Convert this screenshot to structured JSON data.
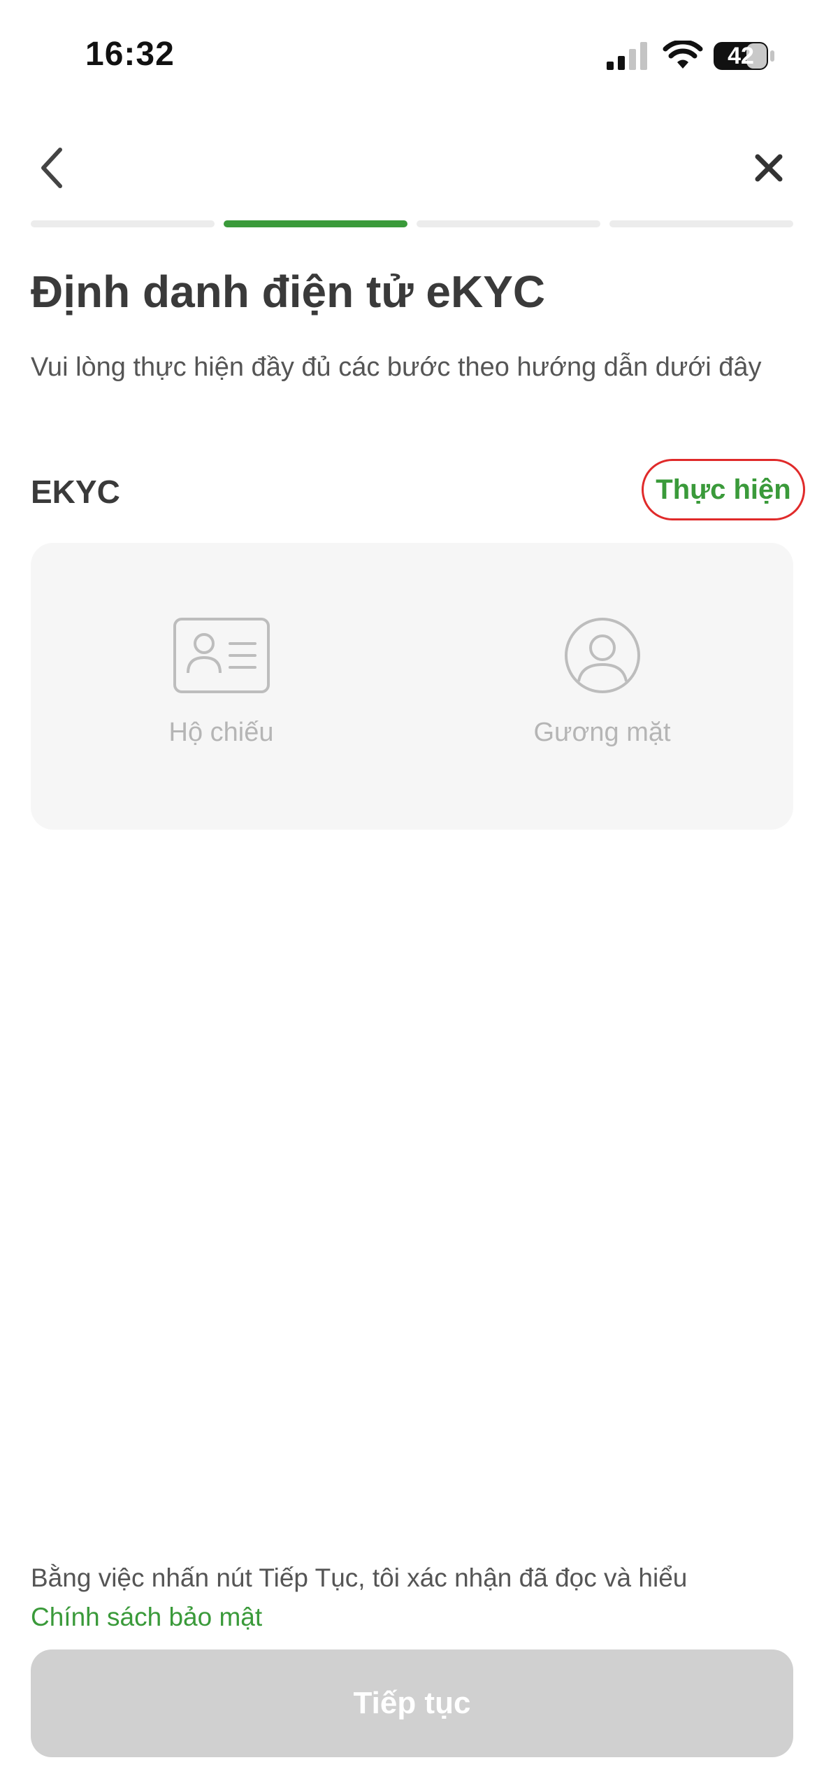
{
  "status_bar": {
    "time": "16:32",
    "battery_level": "42",
    "icons": [
      "signal-icon",
      "wifi-icon",
      "battery-icon"
    ]
  },
  "nav": {
    "back_icon": "chevron-left-icon",
    "close_icon": "close-icon"
  },
  "progress": {
    "total_steps": 4,
    "current_step": 2,
    "active_color": "#3a9a3a"
  },
  "header": {
    "title": "Định danh điện tử eKYC",
    "subtitle": "Vui lòng thực hiện đầy đủ các bước theo hướng dẫn dưới đây"
  },
  "ekyc": {
    "label": "EKYC",
    "action_label": "Thực hiện",
    "items": [
      {
        "label": "Hộ chiếu",
        "icon": "id-card-icon"
      },
      {
        "label": "Gương mặt",
        "icon": "face-user-icon"
      }
    ]
  },
  "footer": {
    "consent_text": "Bằng việc nhấn nút Tiếp Tục, tôi xác nhận đã đọc và hiểu",
    "policy_link": "Chính sách bảo mật",
    "continue_label": "Tiếp tục"
  },
  "colors": {
    "accent": "#3a9a3a",
    "highlight_ring": "#e02a2a",
    "disabled_button": "#d0d0d0"
  }
}
